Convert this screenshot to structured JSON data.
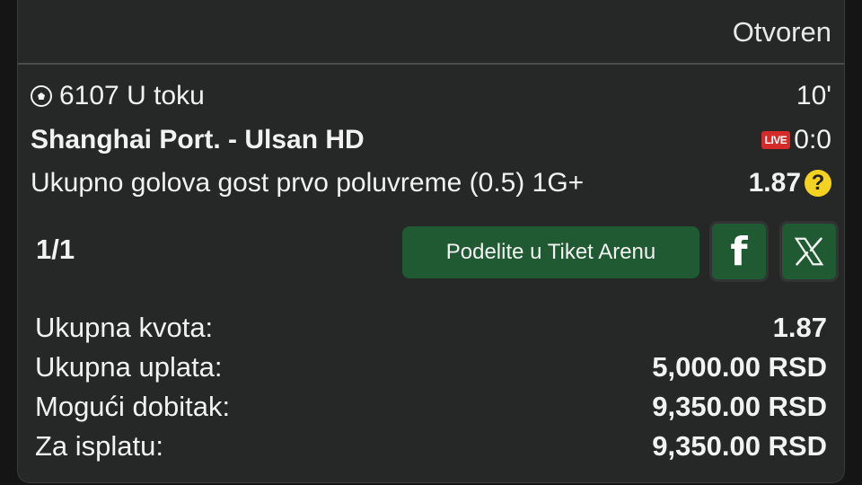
{
  "ticket": {
    "status": "Otvoren"
  },
  "event": {
    "code_line": "6107 U toku",
    "minute": "10'",
    "teams": "Shanghai Port. - Ulsan HD",
    "live_badge": "LIVE",
    "score": "0:0",
    "market": "Ukupno golova gost prvo poluvreme (0.5) 1G+",
    "odd": "1.87",
    "help_symbol": "?",
    "sport_icon": "soccer-ball-icon"
  },
  "counter": "1/1",
  "share": {
    "label": "Podelite u Tiket Arenu",
    "facebook_glyph": "f",
    "accent": "#1f5a32"
  },
  "summary": [
    {
      "label": "Ukupna kvota:",
      "value": "1.87"
    },
    {
      "label": "Ukupna uplata:",
      "value": "5,000.00 RSD"
    },
    {
      "label": "Mogući dobitak:",
      "value": "9,350.00 RSD"
    },
    {
      "label": "Za isplatu:",
      "value": "9,350.00 RSD"
    }
  ]
}
